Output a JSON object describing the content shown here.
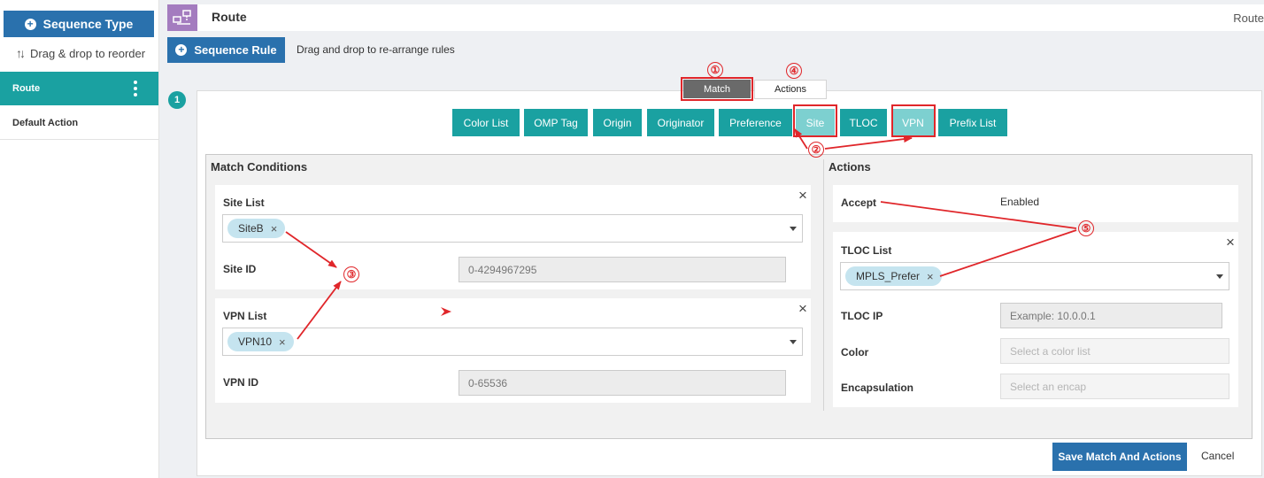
{
  "sidebar": {
    "sequence_type_label": "Sequence Type",
    "drag_hint": "Drag & drop to reorder",
    "items": [
      {
        "label": "Route",
        "active": true
      },
      {
        "label": "Default Action",
        "active": false
      }
    ]
  },
  "header": {
    "title": "Route",
    "right_text": "Route"
  },
  "sequence_rule": {
    "button_label": "Sequence Rule",
    "hint": "Drag and drop to re-arrange rules",
    "number": "1"
  },
  "tabs": {
    "match": "Match",
    "actions": "Actions"
  },
  "conditions": [
    "Color List",
    "OMP Tag",
    "Origin",
    "Originator",
    "Preference",
    "Site",
    "TLOC",
    "VPN",
    "Prefix List"
  ],
  "match_conditions": {
    "heading": "Match Conditions",
    "site_list_label": "Site List",
    "site_list_value": "SiteB",
    "site_id_label": "Site ID",
    "site_id_placeholder": "0-4294967295",
    "vpn_list_label": "VPN List",
    "vpn_list_value": "VPN10",
    "vpn_id_label": "VPN ID",
    "vpn_id_placeholder": "0-65536"
  },
  "actions": {
    "heading": "Actions",
    "accept_label": "Accept",
    "accept_value": "Enabled",
    "tloc_list_label": "TLOC List",
    "tloc_list_value": "MPLS_Prefer",
    "tloc_ip_label": "TLOC IP",
    "tloc_ip_placeholder": "Example: 10.0.0.1",
    "color_label": "Color",
    "color_placeholder": "Select a color list",
    "encap_label": "Encapsulation",
    "encap_placeholder": "Select an encap"
  },
  "footer": {
    "save_label": "Save Match And Actions",
    "cancel_label": "Cancel"
  },
  "annotations": {
    "markers": [
      "①",
      "②",
      "③",
      "④",
      "⑤"
    ],
    "color": "#e0262a"
  },
  "colors": {
    "primary_blue": "#2a71ad",
    "teal": "#1aa1a1",
    "teal_active": "#7dd0d0",
    "chip": "#c5e4ef",
    "route_icon": "#a47cbf"
  }
}
